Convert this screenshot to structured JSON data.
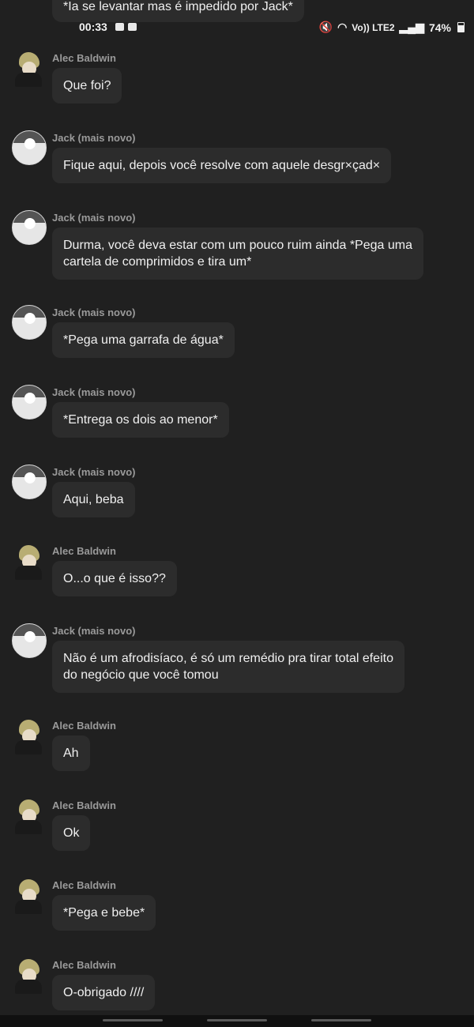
{
  "top_partial_message": "*Ia se levantar mas é impedido por Jack*",
  "status": {
    "time": "00:33",
    "network": "Vo)) LTE2",
    "battery": "74%"
  },
  "messages": [
    {
      "author": "Alec Baldwin",
      "text": "Que foi?",
      "avatar": "alec-avatar"
    },
    {
      "author": "Jack (mais novo)",
      "text": "Fique aqui, depois você resolve com aquele desgr×çad×",
      "avatar": "jack-avatar"
    },
    {
      "author": "Jack (mais novo)",
      "text": "Durma, você deva estar com um pouco ruim ainda *Pega uma\ncartela de comprimidos e tira um*",
      "avatar": "jack-avatar"
    },
    {
      "author": "Jack (mais novo)",
      "text": "*Pega uma garrafa de água*",
      "avatar": "jack-avatar"
    },
    {
      "author": "Jack (mais novo)",
      "text": "*Entrega os dois ao menor*",
      "avatar": "jack-avatar"
    },
    {
      "author": "Jack (mais novo)",
      "text": "Aqui, beba",
      "avatar": "jack-avatar"
    },
    {
      "author": "Alec Baldwin",
      "text": "O...o que é isso??",
      "avatar": "alec-avatar"
    },
    {
      "author": "Jack (mais novo)",
      "text": "Não é um afrodisíaco, é só um remédio pra tirar total efeito\ndo negócio que você tomou",
      "avatar": "jack-avatar"
    },
    {
      "author": "Alec Baldwin",
      "text": "Ah",
      "avatar": "alec-avatar"
    },
    {
      "author": "Alec Baldwin",
      "text": "Ok",
      "avatar": "alec-avatar"
    },
    {
      "author": "Alec Baldwin",
      "text": "*Pega e bebe*",
      "avatar": "alec-avatar"
    },
    {
      "author": "Alec Baldwin",
      "text": "O-obrigado ////",
      "avatar": "alec-avatar"
    }
  ]
}
